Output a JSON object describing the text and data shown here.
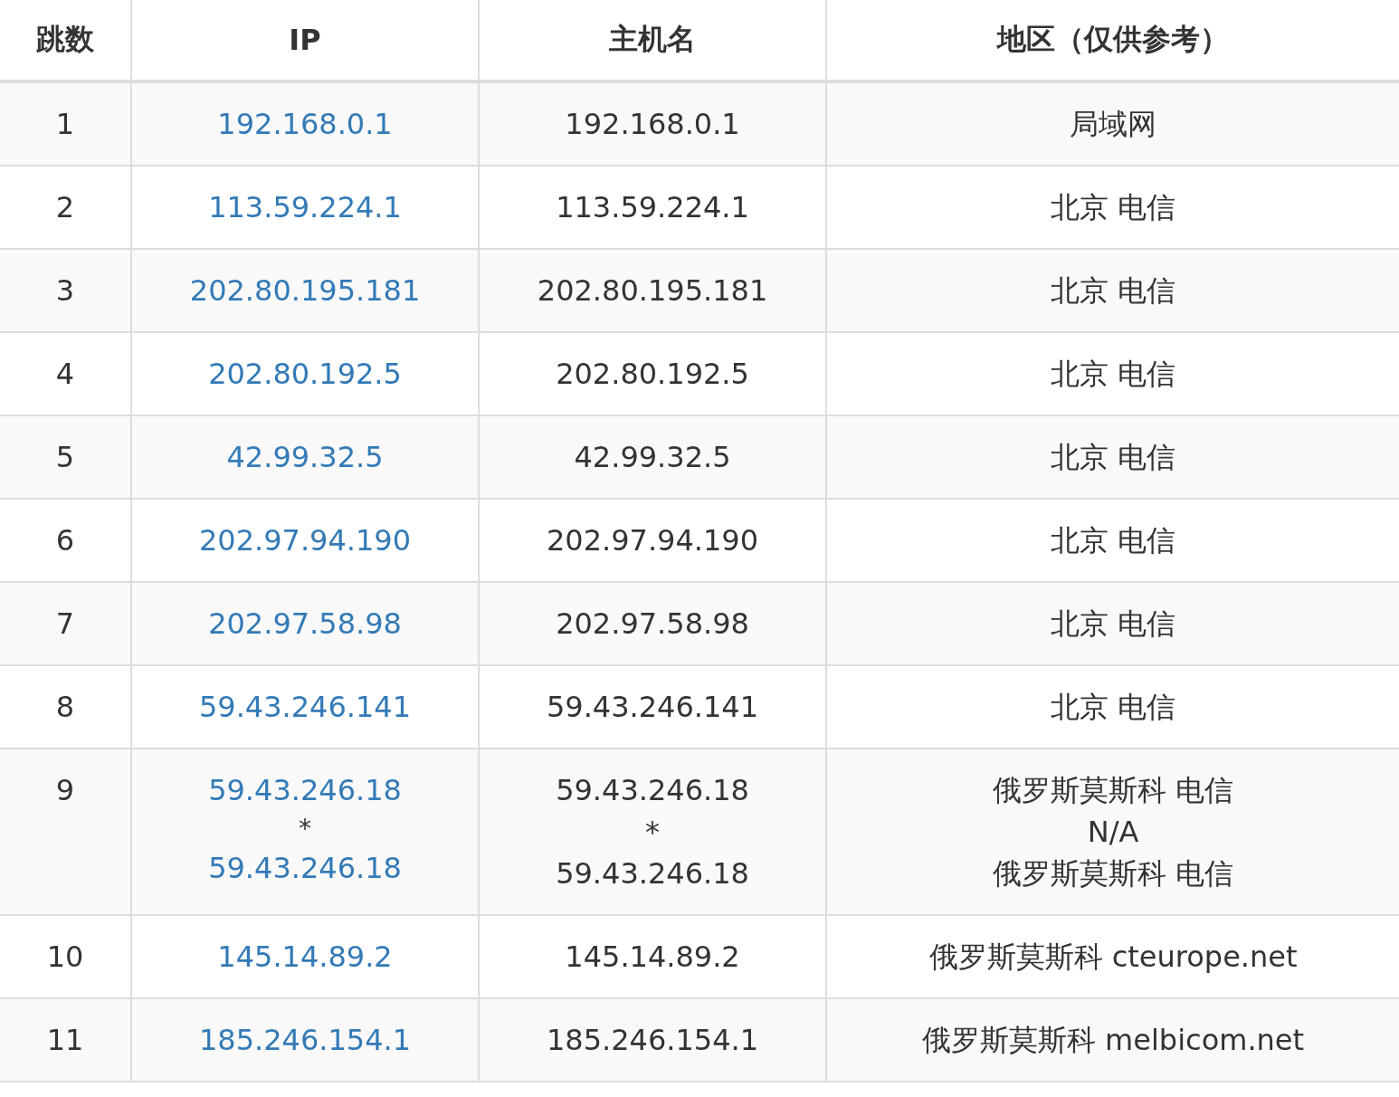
{
  "table": {
    "columns": [
      "跳数",
      "IP",
      "主机名",
      "地区（仅供参考）"
    ],
    "rows": [
      {
        "hop": "1",
        "ips": [
          {
            "kind": "link",
            "text": "192.168.0.1"
          }
        ],
        "hosts": [
          "192.168.0.1"
        ],
        "regions": [
          "局域网"
        ]
      },
      {
        "hop": "2",
        "ips": [
          {
            "kind": "link",
            "text": "113.59.224.1"
          }
        ],
        "hosts": [
          "113.59.224.1"
        ],
        "regions": [
          "北京 电信"
        ]
      },
      {
        "hop": "3",
        "ips": [
          {
            "kind": "link",
            "text": "202.80.195.181"
          }
        ],
        "hosts": [
          "202.80.195.181"
        ],
        "regions": [
          "北京 电信"
        ]
      },
      {
        "hop": "4",
        "ips": [
          {
            "kind": "link",
            "text": "202.80.192.5"
          }
        ],
        "hosts": [
          "202.80.192.5"
        ],
        "regions": [
          "北京 电信"
        ]
      },
      {
        "hop": "5",
        "ips": [
          {
            "kind": "link",
            "text": "42.99.32.5"
          }
        ],
        "hosts": [
          "42.99.32.5"
        ],
        "regions": [
          "北京 电信"
        ]
      },
      {
        "hop": "6",
        "ips": [
          {
            "kind": "link",
            "text": "202.97.94.190"
          }
        ],
        "hosts": [
          "202.97.94.190"
        ],
        "regions": [
          "北京 电信"
        ]
      },
      {
        "hop": "7",
        "ips": [
          {
            "kind": "link",
            "text": "202.97.58.98"
          }
        ],
        "hosts": [
          "202.97.58.98"
        ],
        "regions": [
          "北京 电信"
        ]
      },
      {
        "hop": "8",
        "ips": [
          {
            "kind": "link",
            "text": "59.43.246.141"
          }
        ],
        "hosts": [
          "59.43.246.141"
        ],
        "regions": [
          "北京 电信"
        ]
      },
      {
        "hop": "9",
        "ips": [
          {
            "kind": "link",
            "text": "59.43.246.18"
          },
          {
            "kind": "plain",
            "text": "*"
          },
          {
            "kind": "link",
            "text": "59.43.246.18"
          }
        ],
        "hosts": [
          "59.43.246.18",
          "*",
          "59.43.246.18"
        ],
        "regions": [
          "俄罗斯莫斯科 电信",
          "N/A",
          "俄罗斯莫斯科 电信"
        ]
      },
      {
        "hop": "10",
        "ips": [
          {
            "kind": "link",
            "text": "145.14.89.2"
          }
        ],
        "hosts": [
          "145.14.89.2"
        ],
        "regions": [
          "俄罗斯莫斯科 cteurope.net"
        ]
      },
      {
        "hop": "11",
        "ips": [
          {
            "kind": "link",
            "text": "185.246.154.1"
          }
        ],
        "hosts": [
          "185.246.154.1"
        ],
        "regions": [
          "俄罗斯莫斯科 melbicom.net"
        ]
      }
    ]
  }
}
